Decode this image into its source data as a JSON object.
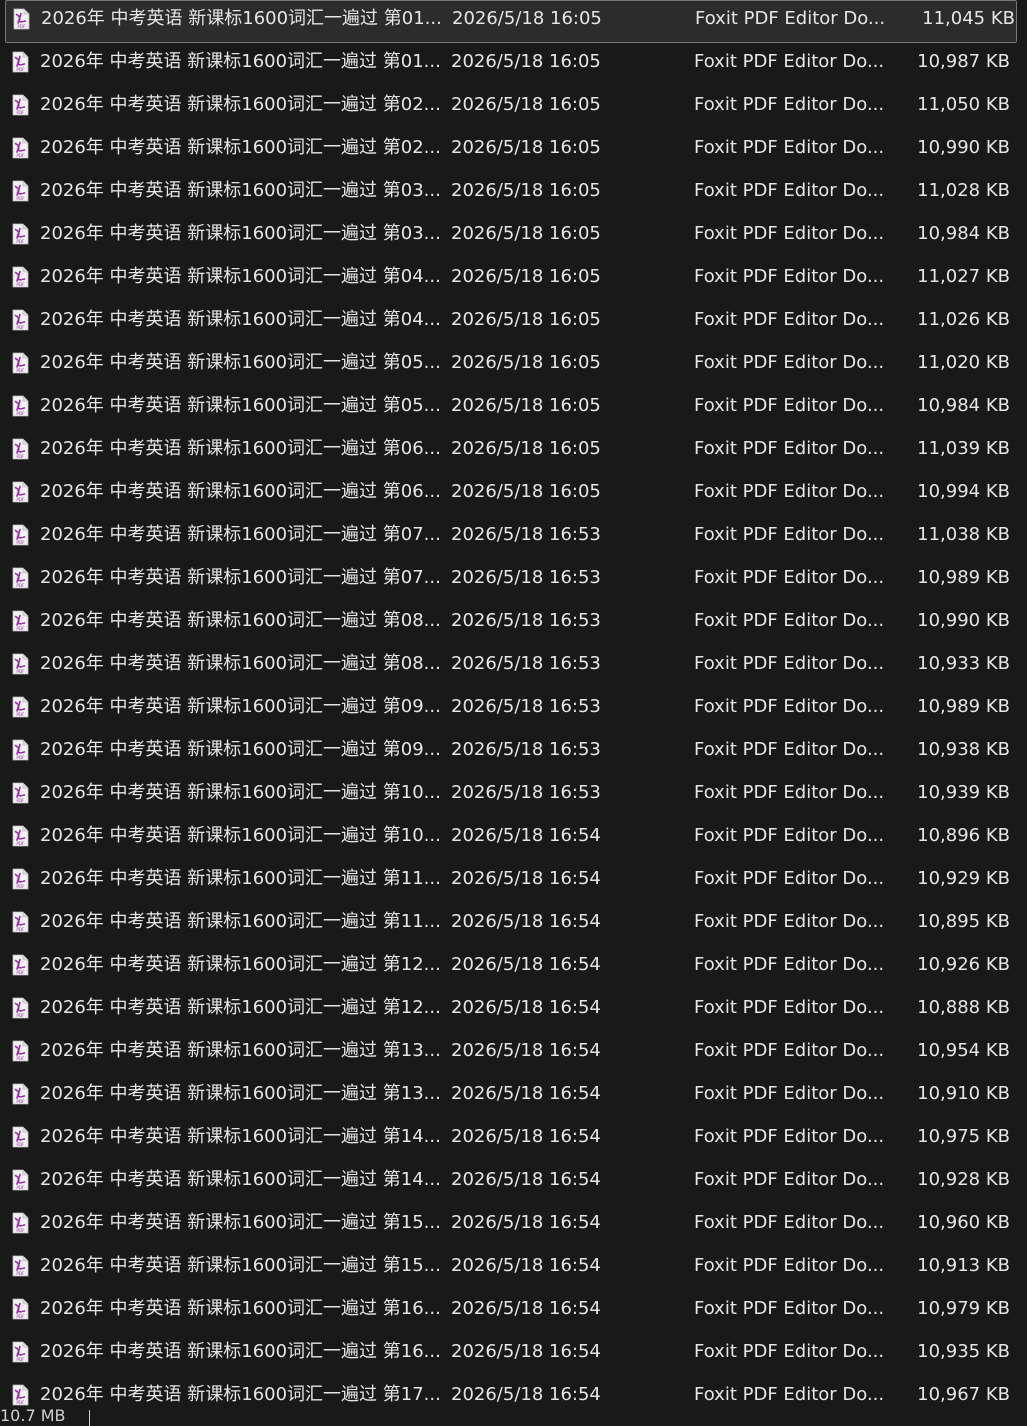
{
  "colors": {
    "background": "#191919",
    "text": "#e6e6e6",
    "selection_bg": "#2c2c2c",
    "selection_border": "#777777",
    "pdf_icon_accent": "#9b2fae"
  },
  "icons": {
    "file_icon": "pdf-file-icon"
  },
  "files": [
    {
      "name": "2026年 中考英语 新课标1600词汇一遍过 第01...",
      "date": "2026/5/18 16:05",
      "type": "Foxit PDF Editor Do...",
      "size": "11,045 KB",
      "selected": true
    },
    {
      "name": "2026年 中考英语 新课标1600词汇一遍过 第01...",
      "date": "2026/5/18 16:05",
      "type": "Foxit PDF Editor Do...",
      "size": "10,987 KB"
    },
    {
      "name": "2026年 中考英语 新课标1600词汇一遍过 第02...",
      "date": "2026/5/18 16:05",
      "type": "Foxit PDF Editor Do...",
      "size": "11,050 KB"
    },
    {
      "name": "2026年 中考英语 新课标1600词汇一遍过 第02...",
      "date": "2026/5/18 16:05",
      "type": "Foxit PDF Editor Do...",
      "size": "10,990 KB"
    },
    {
      "name": "2026年 中考英语 新课标1600词汇一遍过 第03...",
      "date": "2026/5/18 16:05",
      "type": "Foxit PDF Editor Do...",
      "size": "11,028 KB"
    },
    {
      "name": "2026年 中考英语 新课标1600词汇一遍过 第03...",
      "date": "2026/5/18 16:05",
      "type": "Foxit PDF Editor Do...",
      "size": "10,984 KB"
    },
    {
      "name": "2026年 中考英语 新课标1600词汇一遍过 第04...",
      "date": "2026/5/18 16:05",
      "type": "Foxit PDF Editor Do...",
      "size": "11,027 KB"
    },
    {
      "name": "2026年 中考英语 新课标1600词汇一遍过 第04...",
      "date": "2026/5/18 16:05",
      "type": "Foxit PDF Editor Do...",
      "size": "11,026 KB"
    },
    {
      "name": "2026年 中考英语 新课标1600词汇一遍过 第05...",
      "date": "2026/5/18 16:05",
      "type": "Foxit PDF Editor Do...",
      "size": "11,020 KB"
    },
    {
      "name": "2026年 中考英语 新课标1600词汇一遍过 第05...",
      "date": "2026/5/18 16:05",
      "type": "Foxit PDF Editor Do...",
      "size": "10,984 KB"
    },
    {
      "name": "2026年 中考英语 新课标1600词汇一遍过 第06...",
      "date": "2026/5/18 16:05",
      "type": "Foxit PDF Editor Do...",
      "size": "11,039 KB"
    },
    {
      "name": "2026年 中考英语 新课标1600词汇一遍过 第06...",
      "date": "2026/5/18 16:05",
      "type": "Foxit PDF Editor Do...",
      "size": "10,994 KB"
    },
    {
      "name": "2026年 中考英语 新课标1600词汇一遍过 第07...",
      "date": "2026/5/18 16:53",
      "type": "Foxit PDF Editor Do...",
      "size": "11,038 KB"
    },
    {
      "name": "2026年 中考英语 新课标1600词汇一遍过 第07...",
      "date": "2026/5/18 16:53",
      "type": "Foxit PDF Editor Do...",
      "size": "10,989 KB"
    },
    {
      "name": "2026年 中考英语 新课标1600词汇一遍过 第08...",
      "date": "2026/5/18 16:53",
      "type": "Foxit PDF Editor Do...",
      "size": "10,990 KB"
    },
    {
      "name": "2026年 中考英语 新课标1600词汇一遍过 第08...",
      "date": "2026/5/18 16:53",
      "type": "Foxit PDF Editor Do...",
      "size": "10,933 KB"
    },
    {
      "name": "2026年 中考英语 新课标1600词汇一遍过 第09...",
      "date": "2026/5/18 16:53",
      "type": "Foxit PDF Editor Do...",
      "size": "10,989 KB"
    },
    {
      "name": "2026年 中考英语 新课标1600词汇一遍过 第09...",
      "date": "2026/5/18 16:53",
      "type": "Foxit PDF Editor Do...",
      "size": "10,938 KB"
    },
    {
      "name": "2026年 中考英语 新课标1600词汇一遍过 第10...",
      "date": "2026/5/18 16:53",
      "type": "Foxit PDF Editor Do...",
      "size": "10,939 KB"
    },
    {
      "name": "2026年 中考英语 新课标1600词汇一遍过 第10...",
      "date": "2026/5/18 16:54",
      "type": "Foxit PDF Editor Do...",
      "size": "10,896 KB"
    },
    {
      "name": "2026年 中考英语 新课标1600词汇一遍过 第11...",
      "date": "2026/5/18 16:54",
      "type": "Foxit PDF Editor Do...",
      "size": "10,929 KB"
    },
    {
      "name": "2026年 中考英语 新课标1600词汇一遍过 第11...",
      "date": "2026/5/18 16:54",
      "type": "Foxit PDF Editor Do...",
      "size": "10,895 KB"
    },
    {
      "name": "2026年 中考英语 新课标1600词汇一遍过 第12...",
      "date": "2026/5/18 16:54",
      "type": "Foxit PDF Editor Do...",
      "size": "10,926 KB"
    },
    {
      "name": "2026年 中考英语 新课标1600词汇一遍过 第12...",
      "date": "2026/5/18 16:54",
      "type": "Foxit PDF Editor Do...",
      "size": "10,888 KB"
    },
    {
      "name": "2026年 中考英语 新课标1600词汇一遍过 第13...",
      "date": "2026/5/18 16:54",
      "type": "Foxit PDF Editor Do...",
      "size": "10,954 KB"
    },
    {
      "name": "2026年 中考英语 新课标1600词汇一遍过 第13...",
      "date": "2026/5/18 16:54",
      "type": "Foxit PDF Editor Do...",
      "size": "10,910 KB"
    },
    {
      "name": "2026年 中考英语 新课标1600词汇一遍过 第14...",
      "date": "2026/5/18 16:54",
      "type": "Foxit PDF Editor Do...",
      "size": "10,975 KB"
    },
    {
      "name": "2026年 中考英语 新课标1600词汇一遍过 第14...",
      "date": "2026/5/18 16:54",
      "type": "Foxit PDF Editor Do...",
      "size": "10,928 KB"
    },
    {
      "name": "2026年 中考英语 新课标1600词汇一遍过 第15...",
      "date": "2026/5/18 16:54",
      "type": "Foxit PDF Editor Do...",
      "size": "10,960 KB"
    },
    {
      "name": "2026年 中考英语 新课标1600词汇一遍过 第15...",
      "date": "2026/5/18 16:54",
      "type": "Foxit PDF Editor Do...",
      "size": "10,913 KB"
    },
    {
      "name": "2026年 中考英语 新课标1600词汇一遍过 第16...",
      "date": "2026/5/18 16:54",
      "type": "Foxit PDF Editor Do...",
      "size": "10,979 KB"
    },
    {
      "name": "2026年 中考英语 新课标1600词汇一遍过 第16...",
      "date": "2026/5/18 16:54",
      "type": "Foxit PDF Editor Do...",
      "size": "10,935 KB"
    },
    {
      "name": "2026年 中考英语 新课标1600词汇一遍过 第17...",
      "date": "2026/5/18 16:54",
      "type": "Foxit PDF Editor Do...",
      "size": "10,967 KB"
    }
  ],
  "status_bar": {
    "selection_size": "10.7 MB"
  }
}
